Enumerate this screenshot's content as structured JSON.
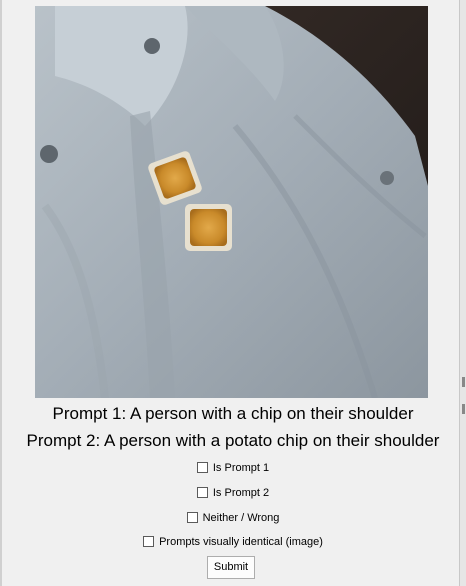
{
  "prompts": {
    "prompt1": "Prompt 1: A person with a chip on their shoulder",
    "prompt2": "Prompt 2: A person with a potato chip on their shoulder"
  },
  "options": [
    {
      "label": "Is Prompt 1",
      "checked": false
    },
    {
      "label": "Is Prompt 2",
      "checked": false
    },
    {
      "label": "Neither / Wrong",
      "checked": false
    },
    {
      "label": "Prompts visually identical (image)",
      "checked": false
    }
  ],
  "submit_label": "Submit"
}
